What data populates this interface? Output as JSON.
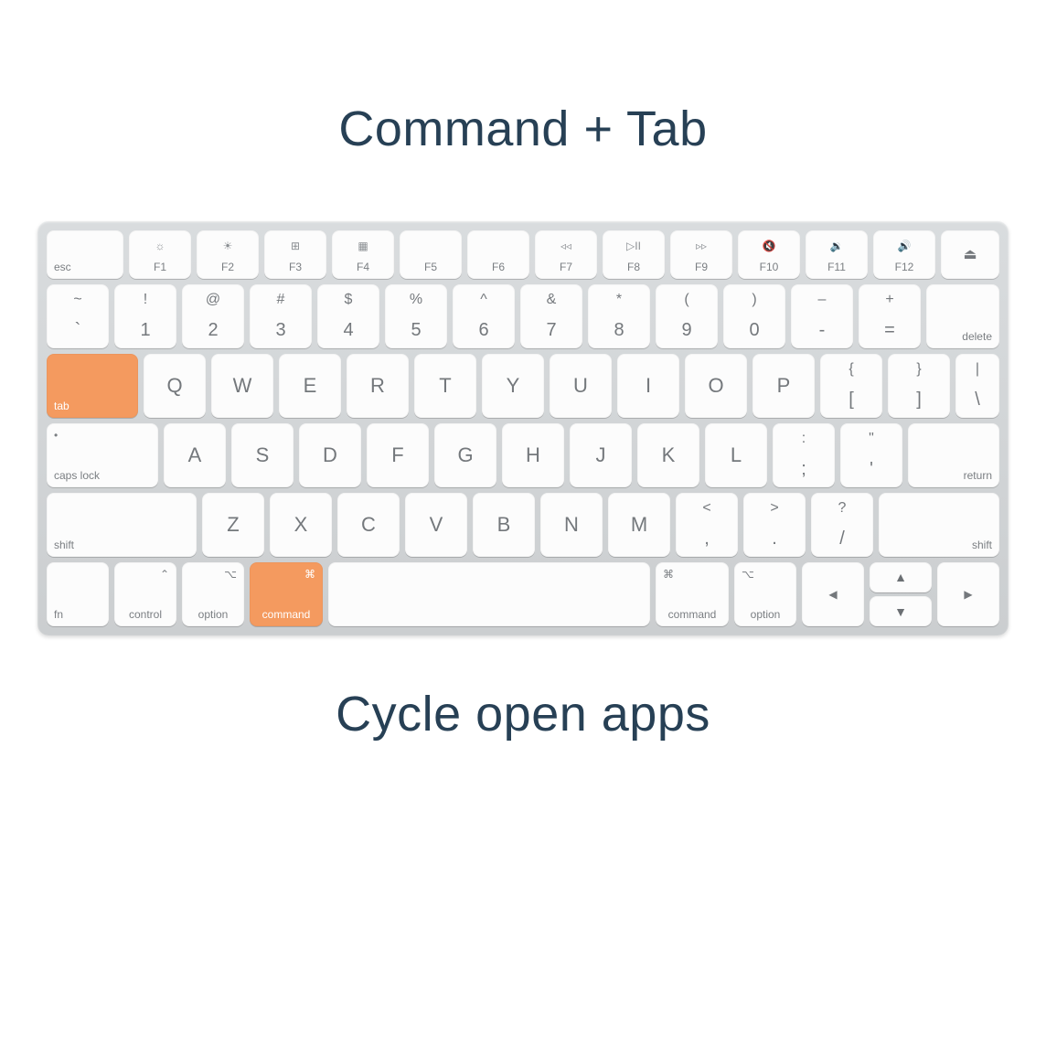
{
  "title": "Command + Tab",
  "subtitle": "Cycle open apps",
  "highlight_color": "#f49a5f",
  "highlighted_keys": [
    "tab",
    "command-left"
  ],
  "rows": {
    "fn": [
      {
        "id": "esc",
        "label": "esc",
        "icon": ""
      },
      {
        "id": "f1",
        "label": "F1",
        "icon": "☼"
      },
      {
        "id": "f2",
        "label": "F2",
        "icon": "☀"
      },
      {
        "id": "f3",
        "label": "F3",
        "icon": "⊞"
      },
      {
        "id": "f4",
        "label": "F4",
        "icon": "▦"
      },
      {
        "id": "f5",
        "label": "F5",
        "icon": ""
      },
      {
        "id": "f6",
        "label": "F6",
        "icon": ""
      },
      {
        "id": "f7",
        "label": "F7",
        "icon": "◃◃"
      },
      {
        "id": "f8",
        "label": "F8",
        "icon": "▷II"
      },
      {
        "id": "f9",
        "label": "F9",
        "icon": "▹▹"
      },
      {
        "id": "f10",
        "label": "F10",
        "icon": "🔇"
      },
      {
        "id": "f11",
        "label": "F11",
        "icon": "🔉"
      },
      {
        "id": "f12",
        "label": "F12",
        "icon": "🔊"
      },
      {
        "id": "eject",
        "label": "",
        "icon": "⏏"
      }
    ],
    "num": [
      {
        "id": "backtick",
        "upper": "~",
        "lower": "`"
      },
      {
        "id": "1",
        "upper": "!",
        "lower": "1"
      },
      {
        "id": "2",
        "upper": "@",
        "lower": "2"
      },
      {
        "id": "3",
        "upper": "#",
        "lower": "3"
      },
      {
        "id": "4",
        "upper": "$",
        "lower": "4"
      },
      {
        "id": "5",
        "upper": "%",
        "lower": "5"
      },
      {
        "id": "6",
        "upper": "^",
        "lower": "6"
      },
      {
        "id": "7",
        "upper": "&",
        "lower": "7"
      },
      {
        "id": "8",
        "upper": "*",
        "lower": "8"
      },
      {
        "id": "9",
        "upper": "(",
        "lower": "9"
      },
      {
        "id": "0",
        "upper": ")",
        "lower": "0"
      },
      {
        "id": "minus",
        "upper": "–",
        "lower": "-"
      },
      {
        "id": "equal",
        "upper": "+",
        "lower": "="
      },
      {
        "id": "delete",
        "label": "delete"
      }
    ],
    "q": {
      "tab": "tab",
      "letters": [
        "Q",
        "W",
        "E",
        "R",
        "T",
        "Y",
        "U",
        "I",
        "O",
        "P"
      ],
      "bracket_open": {
        "upper": "{",
        "lower": "["
      },
      "bracket_close": {
        "upper": "}",
        "lower": "]"
      },
      "backslash": {
        "upper": "|",
        "lower": "\\"
      }
    },
    "a": {
      "caps": "caps lock",
      "letters": [
        "A",
        "S",
        "D",
        "F",
        "G",
        "H",
        "J",
        "K",
        "L"
      ],
      "semicolon": {
        "upper": ":",
        "lower": ";"
      },
      "quote": {
        "upper": "\"",
        "lower": "'"
      },
      "return": "return"
    },
    "z": {
      "shift_l": "shift",
      "letters": [
        "Z",
        "X",
        "C",
        "V",
        "B",
        "N",
        "M"
      ],
      "comma": {
        "upper": "<",
        "lower": ","
      },
      "period": {
        "upper": ">",
        "lower": "."
      },
      "slash": {
        "upper": "?",
        "lower": "/"
      },
      "shift_r": "shift"
    },
    "bottom": {
      "fn": "fn",
      "control": {
        "label": "control",
        "icon": "⌃"
      },
      "option_l": {
        "label": "option",
        "icon": "⌥"
      },
      "command_l": {
        "label": "command",
        "icon": "⌘"
      },
      "command_r": {
        "label": "command",
        "icon": "⌘"
      },
      "option_r": {
        "label": "option",
        "icon": "⌥"
      },
      "arrows": {
        "left": "◀",
        "up": "▲",
        "down": "▼",
        "right": "▶"
      }
    }
  }
}
